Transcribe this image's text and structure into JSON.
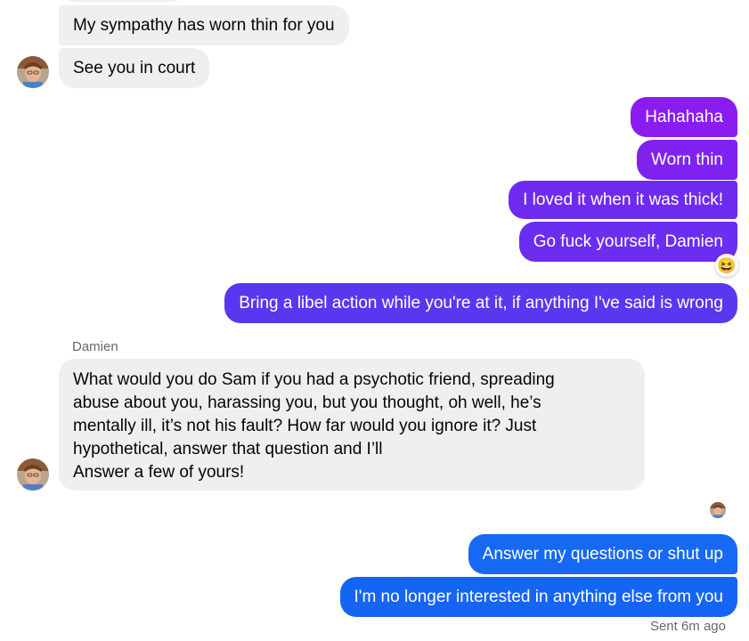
{
  "colors": {
    "incoming_bubble": "#efefef",
    "outgoing_purple": "#8a1cf0",
    "outgoing_violet": "#6b2df0",
    "outgoing_indigo": "#5a37ee",
    "outgoing_blue": "#1565f5",
    "muted_text": "#65676b"
  },
  "conversation": {
    "incoming_top": [
      {
        "text": "My sympathy has worn thin for you"
      },
      {
        "text": "See you in court"
      }
    ],
    "outgoing_group_1": [
      {
        "text": "Hahahaha"
      },
      {
        "text": "Worn thin"
      },
      {
        "text": "I loved it when it was thick!"
      },
      {
        "text": "Go fuck yourself, Damien",
        "reaction_icon": "laughing-face-icon",
        "reaction": "😆"
      },
      {
        "text": "Bring a libel action while you're at it, if anything I've said is wrong"
      }
    ],
    "sender_name": "Damien",
    "incoming_long": {
      "lines": [
        "What would you do Sam if you had a psychotic friend, spreading",
        "abuse about you, harassing you, but you thought, oh well, he’s",
        "mentally ill, it’s not his fault? How far would you ignore it? Just",
        "hypothetical, answer that question and I’ll",
        "Answer a few of yours!"
      ]
    },
    "outgoing_group_2": [
      {
        "text": "Answer my questions or shut up"
      },
      {
        "text": "I'm no longer interested in anything else from you"
      }
    ],
    "status": "Sent 6m ago"
  }
}
